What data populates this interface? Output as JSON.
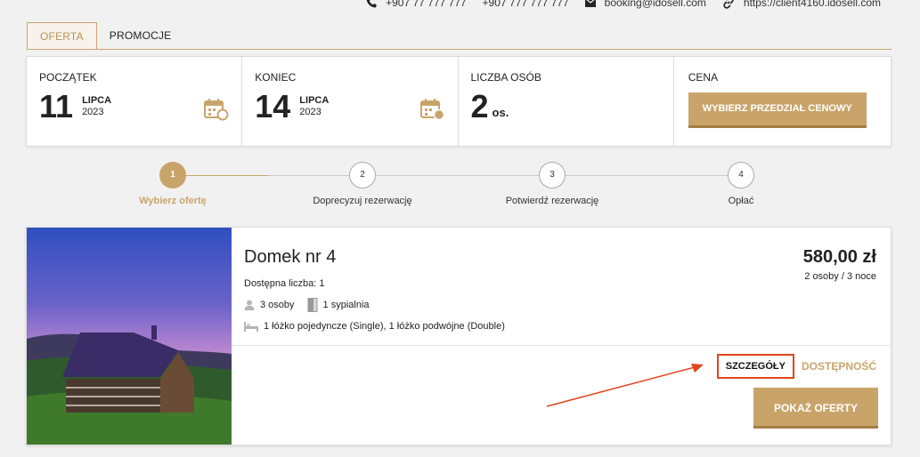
{
  "contacts": {
    "phone1": "+907 77 777 777",
    "phone2": "+907 777 777 777",
    "email": "booking@idosell.com",
    "website": "https://client4160.idosell.com"
  },
  "tabs": [
    {
      "label": "OFERTA",
      "active": true
    },
    {
      "label": "PROMOCJE",
      "active": false
    }
  ],
  "search": {
    "start": {
      "label": "POCZĄTEK",
      "day": "11",
      "month": "LIPCA",
      "year": "2023"
    },
    "end": {
      "label": "KONIEC",
      "day": "14",
      "month": "LIPCA",
      "year": "2023"
    },
    "persons": {
      "label": "LICZBA OSÓB",
      "value": "2",
      "unit": "os."
    },
    "price": {
      "label": "CENA",
      "button": "WYBIERZ PRZEDZIAŁ CENOWY"
    }
  },
  "steps": [
    {
      "num": "1",
      "label": "Wybierz ofertę",
      "active": true
    },
    {
      "num": "2",
      "label": "Doprecyzuj rezerwację",
      "active": false
    },
    {
      "num": "3",
      "label": "Potwierdź rezerwację",
      "active": false
    },
    {
      "num": "4",
      "label": "Opłać",
      "active": false
    }
  ],
  "offer": {
    "title": "Domek nr 4",
    "available": "Dostępna liczba: 1",
    "persons": "3 osoby",
    "bedrooms": "1 sypialnia",
    "beds": "1 łóżko pojedyncze (Single), 1 łóżko podwójne (Double)",
    "price": "580,00 zł",
    "price_note": "2 osoby / 3 noce",
    "details_label": "SZCZEGÓŁY",
    "availability_label": "DOSTĘPNOŚĆ",
    "show_offers_label": "POKAŻ OFERTY"
  },
  "colors": {
    "accent": "#c9a46a",
    "highlight": "#e2451d"
  }
}
